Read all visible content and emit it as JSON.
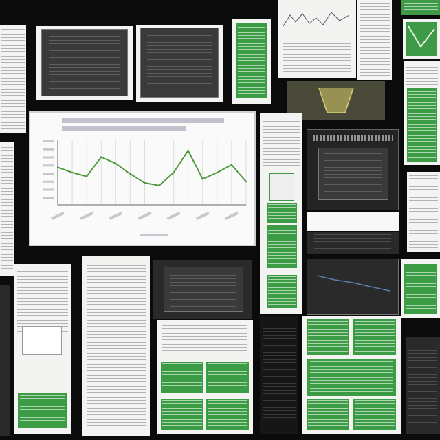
{
  "palette": {
    "background": "#0b0b0b",
    "paper": "#f3f3f1",
    "green": "#3f9a47",
    "line": "#4e9a3c",
    "dark_panel": "#2a2a2a"
  },
  "collage": {
    "icon_set": [
      "document",
      "chart",
      "spreadsheet"
    ],
    "main_chart": {
      "type": "line",
      "series_color": "#4e9a3c",
      "grid": true
    }
  },
  "chart_data": {
    "type": "line",
    "title": "",
    "xlabel": "",
    "ylabel": "",
    "x": [
      1,
      2,
      3,
      4,
      5,
      6,
      7,
      8,
      9,
      10,
      11,
      12,
      13,
      14
    ],
    "series": [
      {
        "values": [
          58,
          50,
          44,
          74,
          64,
          48,
          34,
          30,
          50,
          84,
          40,
          50,
          62,
          36
        ]
      }
    ],
    "ylim": [
      0,
      100
    ],
    "grid": true
  }
}
